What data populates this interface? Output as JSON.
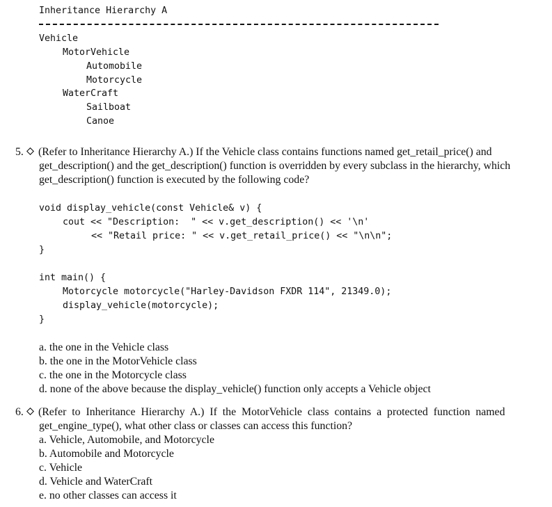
{
  "hierarchy": {
    "title": "Inheritance Hierarchy A",
    "rule": "----------------------------------------------------------------------",
    "items": [
      {
        "label": "Vehicle",
        "level": 0
      },
      {
        "label": "MotorVehicle",
        "level": 1
      },
      {
        "label": "Automobile",
        "level": 2
      },
      {
        "label": "Motorcycle",
        "level": 2
      },
      {
        "label": "WaterCraft",
        "level": 1
      },
      {
        "label": "Sailboat",
        "level": 2
      },
      {
        "label": "Canoe",
        "level": 2
      }
    ]
  },
  "question5": {
    "number": "5.",
    "icon": "diamond-icon",
    "lines": [
      "(Refer to Inheritance Hierarchy A.) If the Vehicle class contains functions named get_retail_price() and",
      "get_description() and the get_description() function is overridden by every subclass in the hierarchy, which",
      "get_description() function is executed by the following code?"
    ],
    "code": [
      {
        "indent": 0,
        "text": "void display_vehicle(const Vehicle& v) {"
      },
      {
        "indent": 1,
        "text": "cout << \"Description:  \" << v.get_description() << '\\n'"
      },
      {
        "indent": 2,
        "text": "<< \"Retail price: \" << v.get_retail_price() << \"\\n\\n\";"
      },
      {
        "indent": 0,
        "text": "}"
      },
      {
        "indent": 0,
        "text": ""
      },
      {
        "indent": 0,
        "text": "int main() {"
      },
      {
        "indent": 1,
        "text": "Motorcycle motorcycle(\"Harley-Davidson FXDR 114\", 21349.0);"
      },
      {
        "indent": 1,
        "text": "display_vehicle(motorcycle);"
      },
      {
        "indent": 0,
        "text": "}"
      }
    ],
    "options": [
      "a. the one in the Vehicle class",
      "b. the one in the MotorVehicle class",
      "c. the one in the Motorcycle class",
      "d. none of the above because the display_vehicle() function only accepts a Vehicle object"
    ]
  },
  "question6": {
    "number": "6.",
    "icon": "diamond-icon",
    "lines": [
      "(Refer to Inheritance Hierarchy A.) If the MotorVehicle class contains a protected function named",
      "get_engine_type(), what other class or classes can access this function?"
    ],
    "options": [
      "a. Vehicle, Automobile, and Motorcycle",
      "b. Automobile and Motorcycle",
      "c. Vehicle",
      "d. Vehicle and WaterCraft",
      "e. no other classes can access it"
    ]
  }
}
